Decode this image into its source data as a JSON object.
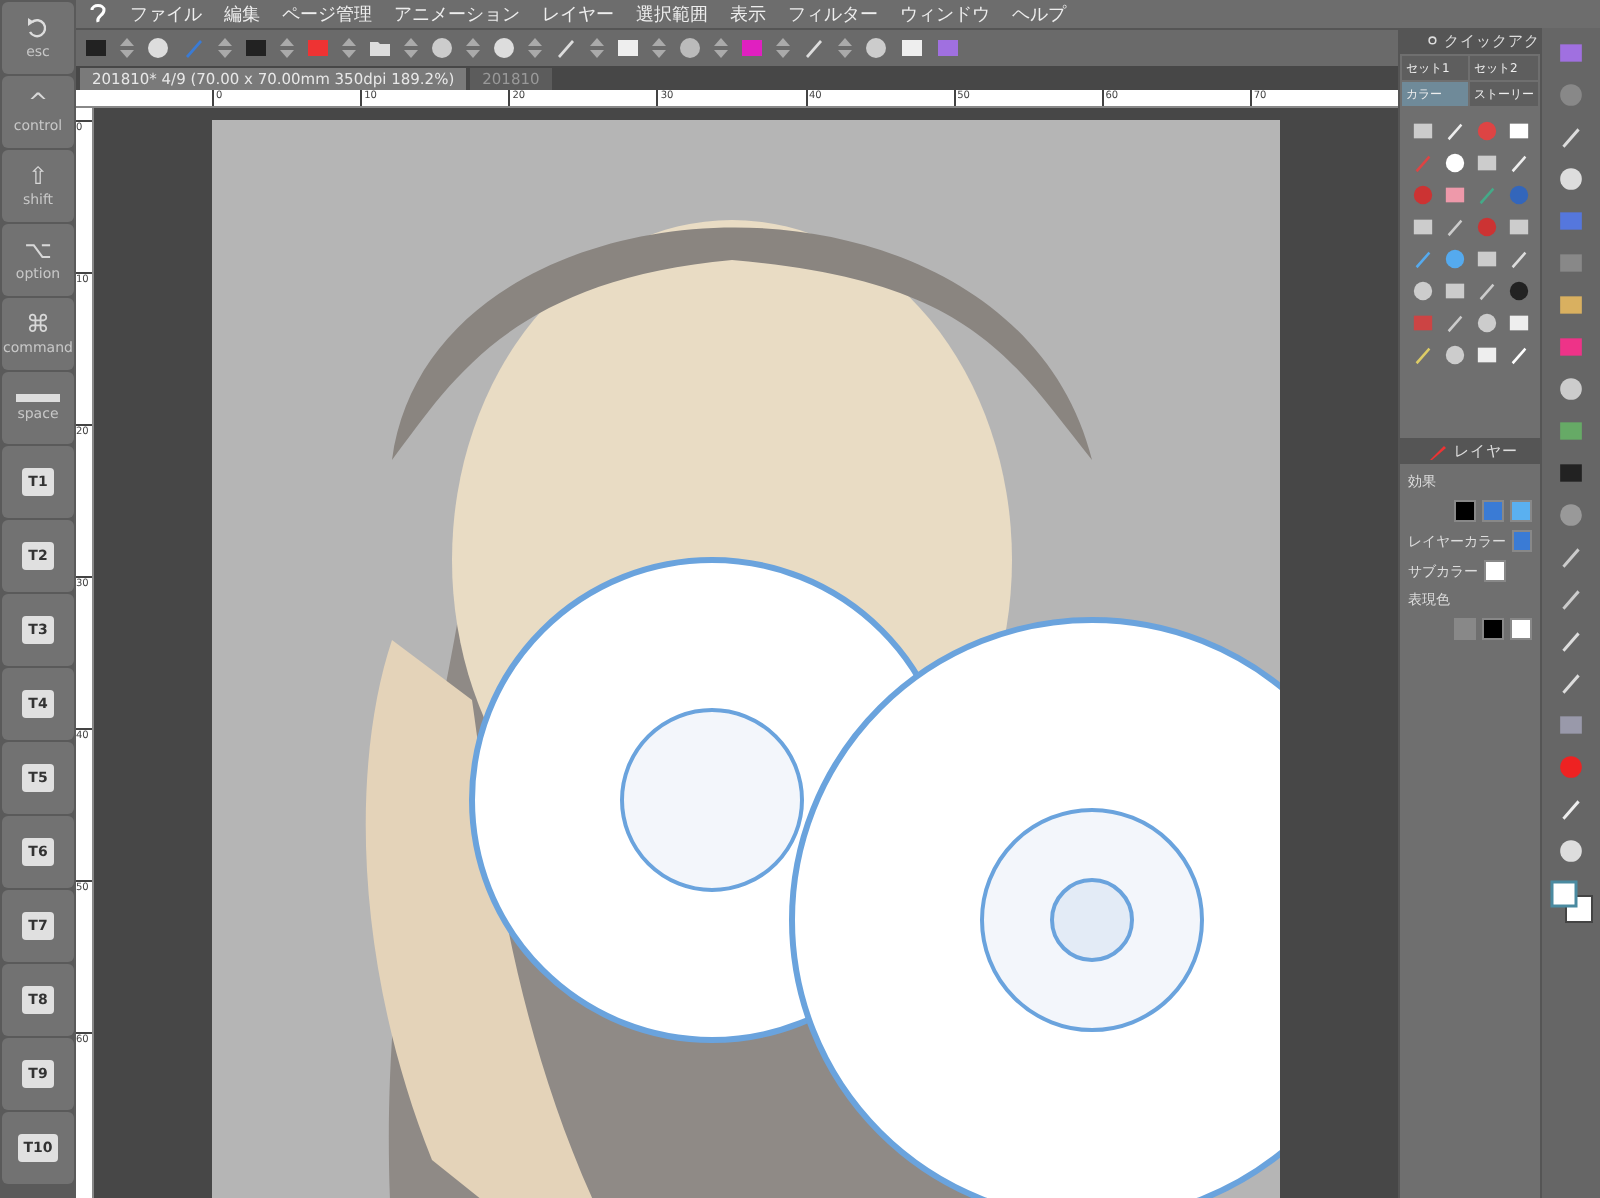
{
  "menu": [
    "ファイル",
    "編集",
    "ページ管理",
    "アニメーション",
    "レイヤー",
    "選択範囲",
    "表示",
    "フィルター",
    "ウィンドウ",
    "ヘルプ"
  ],
  "document_tabs": [
    {
      "label": "201810* 4/9 (70.00 x 70.00mm 350dpi 189.2%)",
      "selected": true
    },
    {
      "label": "201810",
      "selected": false
    }
  ],
  "ruler": {
    "x_labels": [
      "0",
      "10",
      "20",
      "30",
      "40",
      "50",
      "60",
      "70"
    ],
    "y_labels": [
      "0",
      "10",
      "20",
      "30",
      "40",
      "50",
      "60"
    ]
  },
  "keys": [
    {
      "kind": "undo",
      "label": "esc"
    },
    {
      "kind": "symbol",
      "symbol": "^",
      "label": "control"
    },
    {
      "kind": "symbol",
      "symbol": "⇧",
      "label": "shift"
    },
    {
      "kind": "symbol",
      "symbol": "⌥",
      "label": "option"
    },
    {
      "kind": "symbol",
      "symbol": "⌘",
      "label": "command"
    },
    {
      "kind": "space",
      "label": "space"
    },
    {
      "kind": "tile",
      "label": "T1"
    },
    {
      "kind": "tile",
      "label": "T2"
    },
    {
      "kind": "tile",
      "label": "T3"
    },
    {
      "kind": "tile",
      "label": "T4"
    },
    {
      "kind": "tile",
      "label": "T5"
    },
    {
      "kind": "tile",
      "label": "T6"
    },
    {
      "kind": "tile",
      "label": "T7"
    },
    {
      "kind": "tile",
      "label": "T8"
    },
    {
      "kind": "tile",
      "label": "T9"
    },
    {
      "kind": "tile",
      "label": "T10"
    }
  ],
  "quick_access": {
    "title": "クイックアク",
    "tabs": [
      {
        "label": "セット1",
        "selected": false
      },
      {
        "label": "セット2",
        "selected": false
      },
      {
        "label": "カラー",
        "selected": true
      },
      {
        "label": "ストーリー",
        "selected": false
      }
    ]
  },
  "layer_panel": {
    "title": "レイヤー",
    "effect_label": "効果",
    "layer_color_label": "レイヤーカラー",
    "sub_color_label": "サブカラー",
    "expression_label": "表現色"
  }
}
